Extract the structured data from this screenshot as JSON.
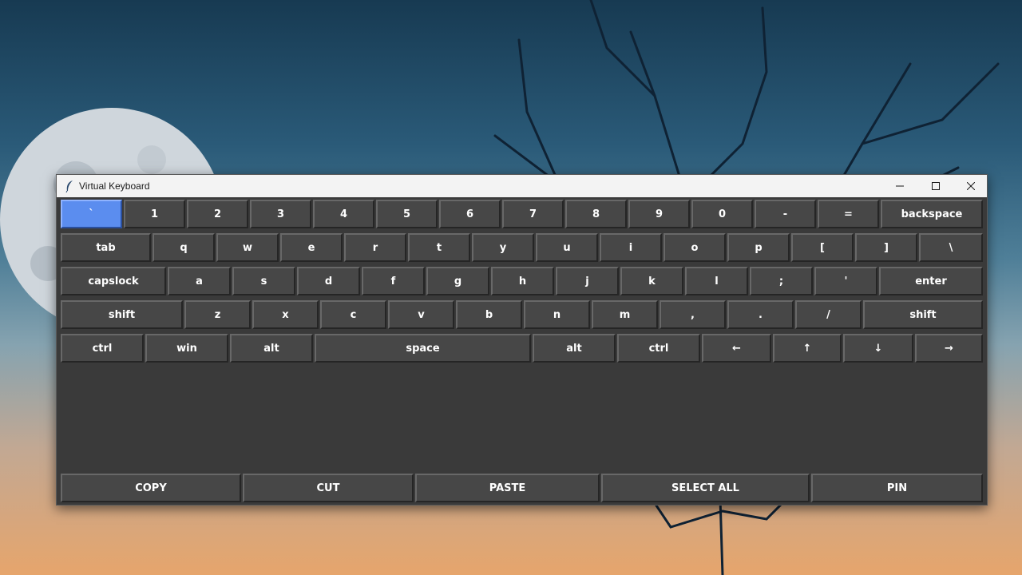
{
  "window": {
    "title": "Virtual Keyboard"
  },
  "keyboard": {
    "active_key": "`",
    "row1": [
      "`",
      "1",
      "2",
      "3",
      "4",
      "5",
      "6",
      "7",
      "8",
      "9",
      "0",
      "-",
      "=",
      "backspace"
    ],
    "row2": [
      "tab",
      "q",
      "w",
      "e",
      "r",
      "t",
      "y",
      "u",
      "i",
      "o",
      "p",
      "[",
      "]",
      "\\"
    ],
    "row3": [
      "capslock",
      "a",
      "s",
      "d",
      "f",
      "g",
      "h",
      "j",
      "k",
      "l",
      ";",
      "'",
      "enter"
    ],
    "row4": [
      "shift",
      "z",
      "x",
      "c",
      "v",
      "b",
      "n",
      "m",
      ",",
      ".",
      "/",
      "shift"
    ],
    "row5": [
      "ctrl",
      "win",
      "alt",
      "space",
      "alt",
      "ctrl",
      "←",
      "↑",
      "↓",
      "→"
    ]
  },
  "actions": [
    "COPY",
    "CUT",
    "PASTE",
    "SELECT ALL",
    "PIN"
  ],
  "colors": {
    "key_bg": "#474747",
    "window_bg": "#3a3a3a",
    "active_key": "#5b8def"
  },
  "icons": {
    "app": "feather-icon",
    "minimize": "minimize-icon",
    "maximize": "maximize-icon",
    "close": "close-icon"
  }
}
